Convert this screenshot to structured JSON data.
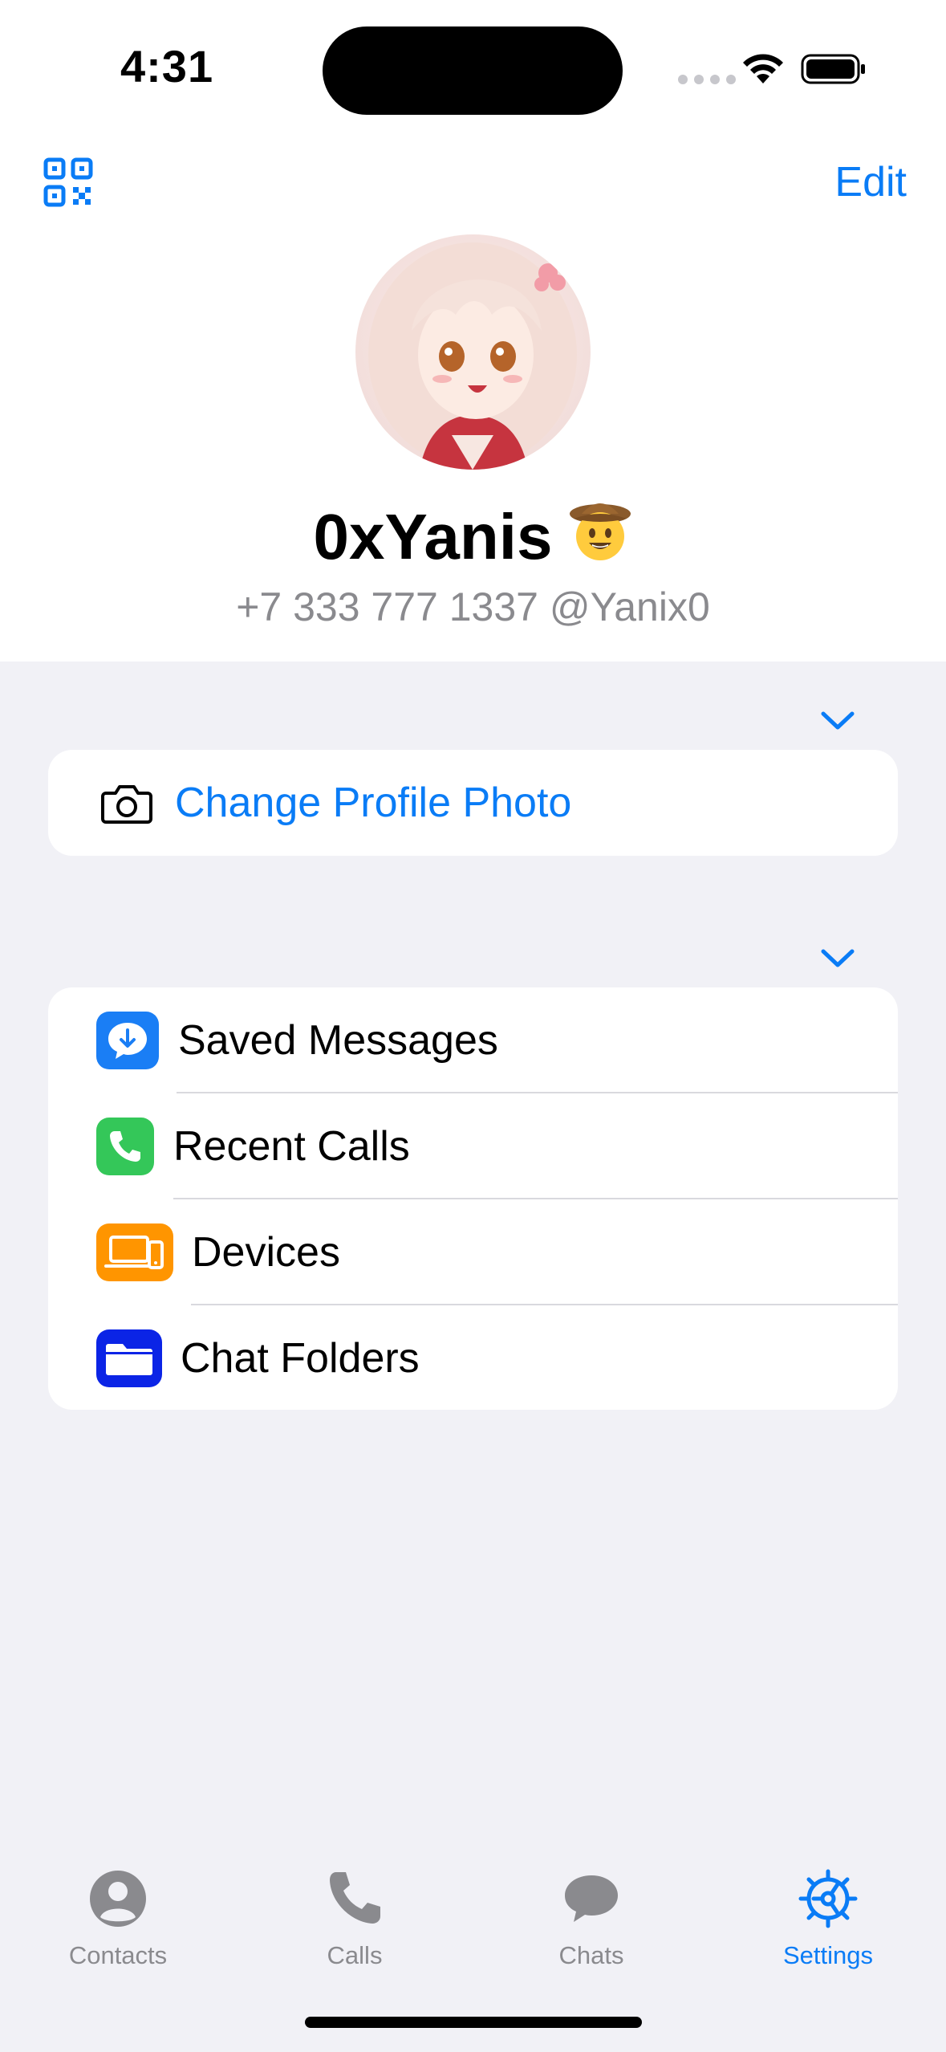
{
  "status_bar": {
    "time": "4:31"
  },
  "header": {
    "edit_label": "Edit"
  },
  "profile": {
    "name": "0xYanis",
    "subtitle": "+7 333 777 1337 @Yanix0"
  },
  "photo_section": {
    "label": "Change Profile Photo"
  },
  "menu": {
    "items": [
      {
        "label": "Saved Messages",
        "icon": "saved-messages-icon",
        "color": "#1a7ef5"
      },
      {
        "label": "Recent Calls",
        "icon": "phone-icon",
        "color": "#34c759"
      },
      {
        "label": "Devices",
        "icon": "devices-icon",
        "color": "#ff9500"
      },
      {
        "label": "Chat Folders",
        "icon": "folder-icon",
        "color": "#0b24e6"
      }
    ]
  },
  "tabbar": {
    "tabs": [
      {
        "label": "Contacts",
        "icon": "contact-icon"
      },
      {
        "label": "Calls",
        "icon": "phone-icon"
      },
      {
        "label": "Chats",
        "icon": "chat-bubble-icon"
      },
      {
        "label": "Settings",
        "icon": "gear-icon",
        "active": true
      }
    ]
  },
  "colors": {
    "accent": "#0a7cf6",
    "background": "#f1f1f6",
    "secondary_text": "#8a8a8e"
  }
}
